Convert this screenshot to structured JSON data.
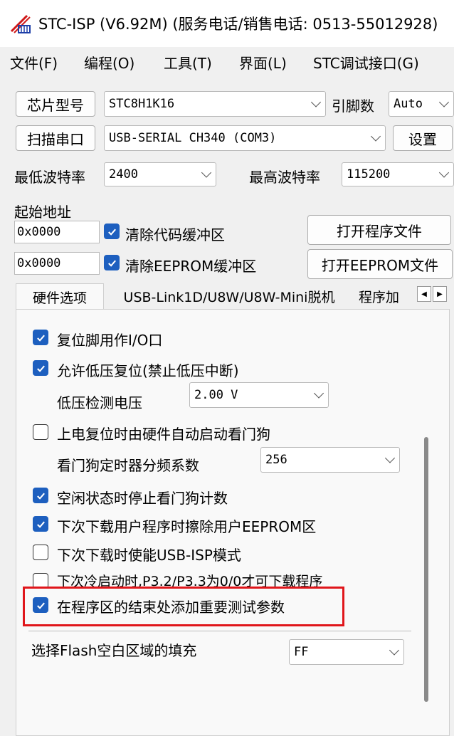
{
  "window": {
    "title": "STC-ISP (V6.92M) (服务电话/销售电话: 0513-55012928)"
  },
  "menu": [
    "文件(F)",
    "编程(O)",
    "工具(T)",
    "界面(L)",
    "STC调试接口(G)"
  ],
  "chip": {
    "button": "芯片型号",
    "value": "STC8H1K16",
    "pin_label": "引脚数",
    "pin_value": "Auto"
  },
  "port": {
    "button": "扫描串口",
    "value": "USB-SERIAL CH340 (COM3)",
    "settings_button": "设置"
  },
  "baud": {
    "min_label": "最低波特率",
    "min_value": "2400",
    "max_label": "最高波特率",
    "max_value": "115200"
  },
  "address": {
    "label": "起始地址",
    "code_addr": "0x0000",
    "code_clear": "清除代码缓冲区",
    "open_program": "打开程序文件",
    "eeprom_addr": "0x0000",
    "eeprom_clear": "清除EEPROM缓冲区",
    "open_eeprom": "打开EEPROM文件"
  },
  "tabs": [
    "硬件选项",
    "USB-Link1D/U8W/U8W-Mini脱机",
    "程序加"
  ],
  "options": {
    "reset_io": "复位脚用作I/O口",
    "lvd_reset": "允许低压复位(禁止低压中断)",
    "lvd_label": "低压检测电压",
    "lvd_value": "2.00 V",
    "watchdog_auto": "上电复位时由硬件自动启动看门狗",
    "wdt_label": "看门狗定时器分频系数",
    "wdt_value": "256",
    "idle_stop_wdt": "空闲状态时停止看门狗计数",
    "erase_eeprom": "下次下载用户程序时擦除用户EEPROM区",
    "usb_isp": "下次下载时使能USB-ISP模式",
    "cold_start": "下次冷启动时,P3.2/P3.3为0/0才可下载程序",
    "add_params": "在程序区的结束处添加重要测试参数",
    "flash_fill_label": "选择Flash空白区域的填充",
    "flash_fill_value": "FF"
  },
  "colors": {
    "checkbox_checked": "#1d5fbf",
    "highlight_border": "#e0161b"
  }
}
